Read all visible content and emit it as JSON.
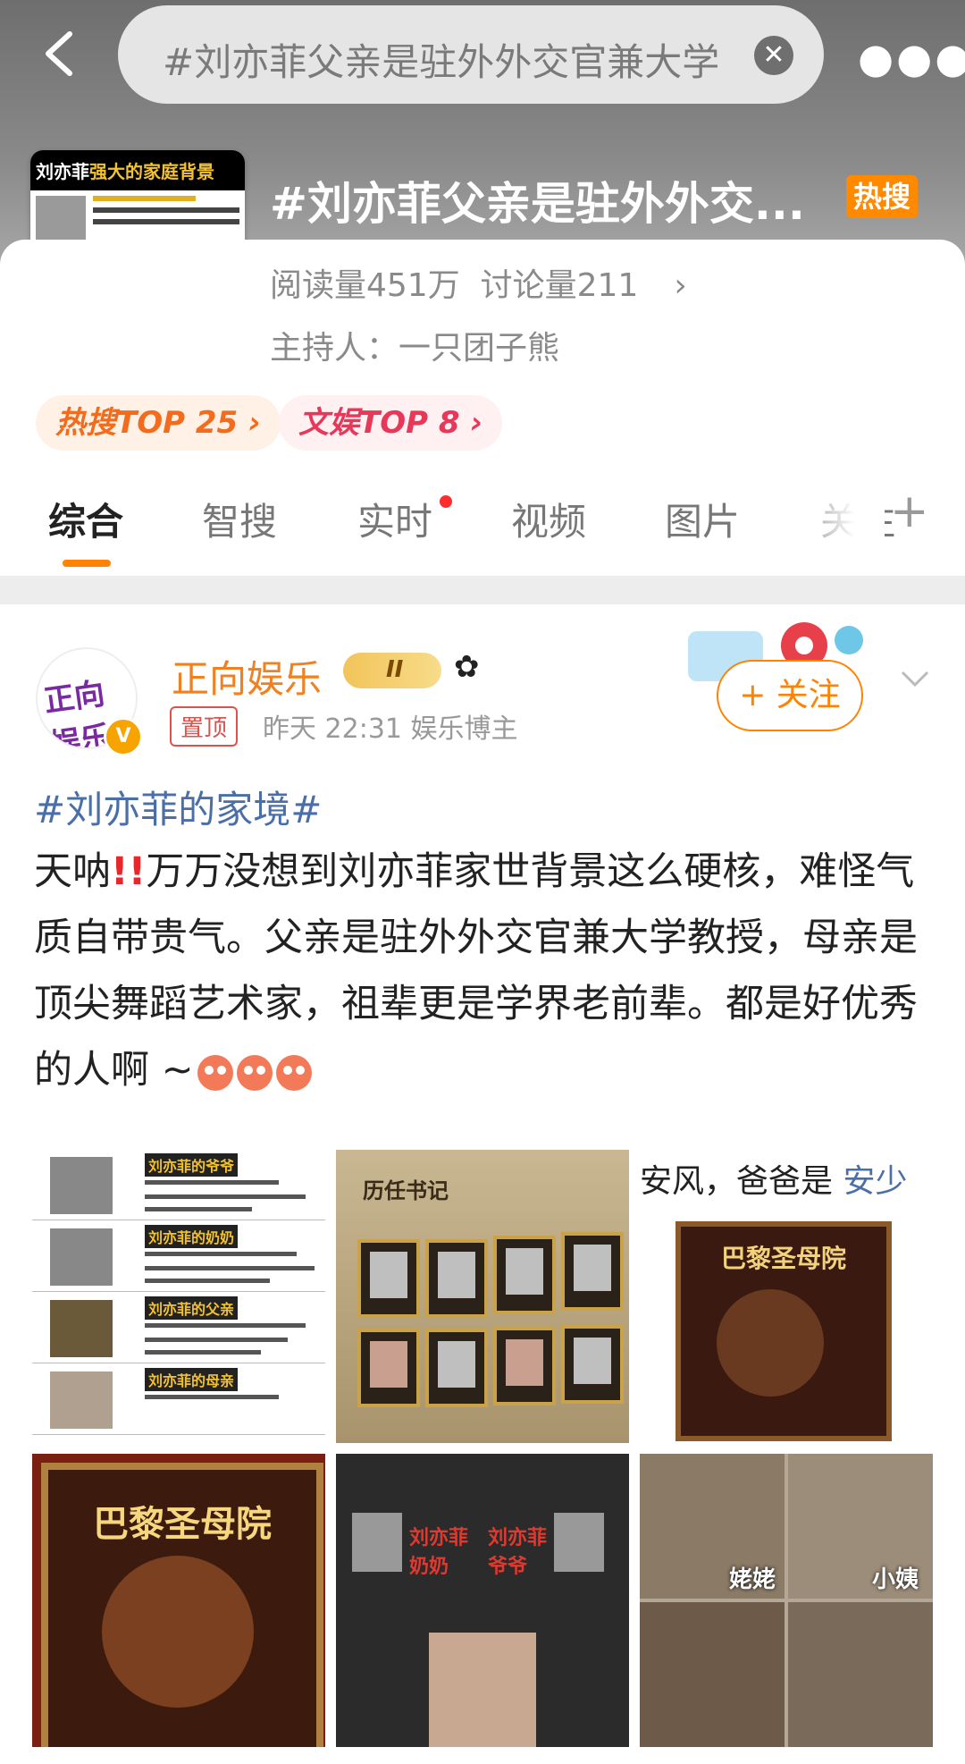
{
  "search": {
    "query": "#刘亦菲父亲是驻外外交官兼大学"
  },
  "topic": {
    "thumb_title_white": "刘亦菲",
    "thumb_title_yellow": "强大的家庭背景",
    "title": "#刘亦菲父亲是驻外外交...",
    "hot_badge": "热搜",
    "reads": "阅读量451万",
    "discussions": "讨论量211",
    "host": "主持人：一只团子熊",
    "rank1": "热搜TOP 25 ›",
    "rank2": "文娱TOP 8 ›"
  },
  "tabs": [
    {
      "label": "综合"
    },
    {
      "label": "智搜"
    },
    {
      "label": "实时"
    },
    {
      "label": "视频"
    },
    {
      "label": "图片"
    },
    {
      "label": "关注"
    }
  ],
  "post": {
    "username": "正向娱乐",
    "avatar_text": "正向娱乐",
    "level": "II",
    "pin_label": "置顶",
    "meta": "昨天 22:31   娱乐博主",
    "follow_label": "+ 关注",
    "hashtag": "#刘亦菲的家境#",
    "text_before": "天呐",
    "text_after": "万万没想到刘亦菲家世背景这么硬核，难怪气质自带贵气。父亲是驻外外交官兼大学教授，母亲是顶尖舞蹈艺术家，祖辈更是学界老前辈。都是好优秀的人啊 ~",
    "images": {
      "img1_tags": [
        "刘亦菲的爷爷",
        "刘亦菲的奶奶",
        "刘亦菲的父亲",
        "刘亦菲的母亲"
      ],
      "img2_title": "历任书记",
      "img3_caption_a": "安风，爸爸是 ",
      "img3_caption_b": "安少",
      "img3_book": "巴黎圣母院",
      "img4_book": "巴黎圣母院",
      "img5_label_a": "刘亦菲 奶奶",
      "img5_label_b": "刘亦菲 爷爷",
      "img6_label_a": "姥姥",
      "img6_label_b": "小姨"
    }
  },
  "colors": {
    "accent": "#ff8200",
    "link": "#4a6fa8",
    "hot": "#ff8a00"
  }
}
